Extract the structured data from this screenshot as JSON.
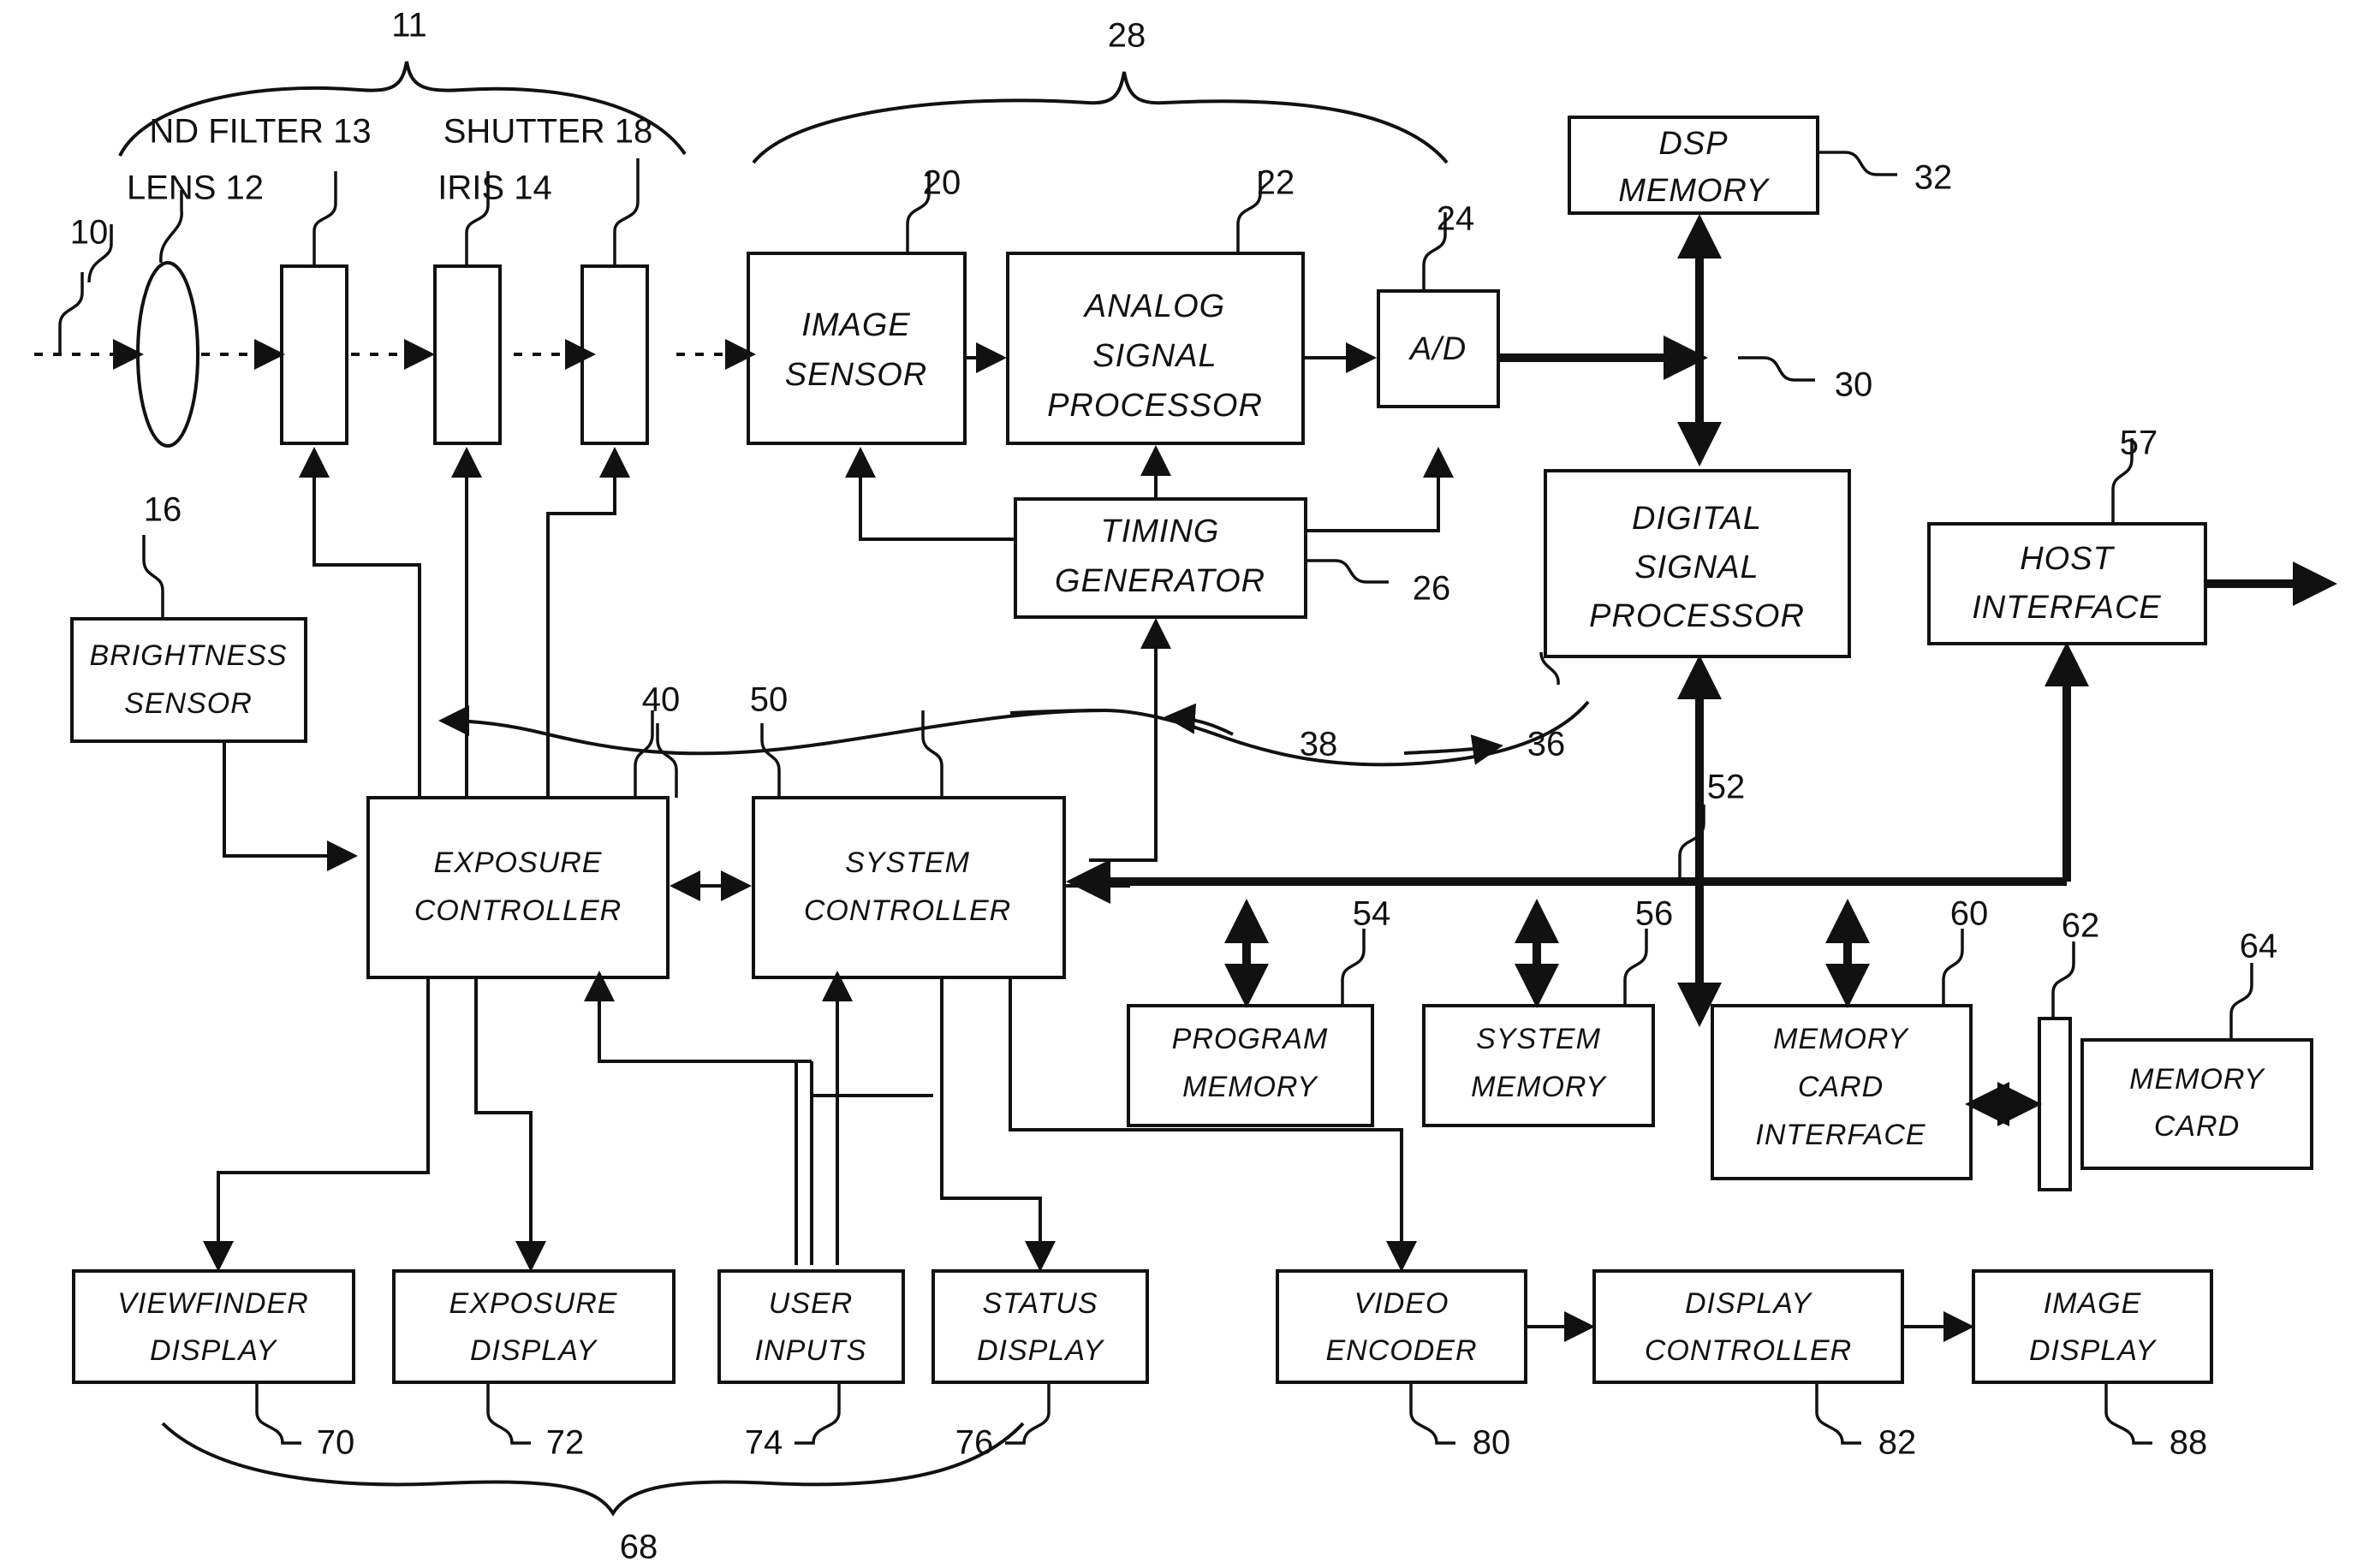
{
  "figure": {
    "type": "patent-block-diagram",
    "title": "Digital camera system block diagram",
    "system_reference": "10",
    "optics_group_reference": "11",
    "sensor_group_reference": "28",
    "display_group_reference": "68"
  },
  "optics_labels": {
    "nd_filter": "ND FILTER 13",
    "shutter": "SHUTTER 18",
    "lens": "LENS 12",
    "iris": "IRIS 14"
  },
  "blocks": {
    "image_sensor": {
      "line1": "IMAGE",
      "line2": "SENSOR",
      "ref": "20"
    },
    "analog_signal_processor": {
      "line1": "ANALOG",
      "line2": "SIGNAL",
      "line3": "PROCESSOR",
      "ref": "22"
    },
    "ad": {
      "line1": "A/D",
      "ref": "24"
    },
    "timing_generator": {
      "line1": "TIMING",
      "line2": "GENERATOR",
      "ref": "26"
    },
    "dsp_memory": {
      "line1": "DSP",
      "line2": "MEMORY",
      "ref": "32"
    },
    "digital_signal_processor": {
      "line1": "DIGITAL",
      "line2": "SIGNAL",
      "line3": "PROCESSOR",
      "ref": "36"
    },
    "host_interface": {
      "line1": "HOST",
      "line2": "INTERFACE",
      "ref": "57"
    },
    "brightness_sensor": {
      "line1": "BRIGHTNESS",
      "line2": "SENSOR",
      "ref": "16"
    },
    "exposure_controller": {
      "line1": "EXPOSURE",
      "line2": "CONTROLLER",
      "ref": "40"
    },
    "system_controller": {
      "line1": "SYSTEM",
      "line2": "CONTROLLER",
      "ref": "50"
    },
    "program_memory": {
      "line1": "PROGRAM",
      "line2": "MEMORY",
      "ref": "54"
    },
    "system_memory": {
      "line1": "SYSTEM",
      "line2": "MEMORY",
      "ref": "56"
    },
    "memory_card_interface": {
      "line1": "MEMORY",
      "line2": "CARD",
      "line3": "INTERFACE",
      "ref": "60"
    },
    "memory_card": {
      "line1": "MEMORY",
      "line2": "CARD",
      "ref": "64"
    },
    "memory_card_slot": {
      "ref": "62"
    },
    "viewfinder_display": {
      "line1": "VIEWFINDER",
      "line2": "DISPLAY",
      "ref": "70"
    },
    "exposure_display": {
      "line1": "EXPOSURE",
      "line2": "DISPLAY",
      "ref": "72"
    },
    "user_inputs": {
      "line1": "USER",
      "line2": "INPUTS",
      "ref": "74"
    },
    "status_display": {
      "line1": "STATUS",
      "line2": "DISPLAY",
      "ref": "76"
    },
    "video_encoder": {
      "line1": "VIDEO",
      "line2": "ENCODER",
      "ref": "80"
    },
    "display_controller": {
      "line1": "DISPLAY",
      "line2": "CONTROLLER",
      "ref": "82"
    },
    "image_display": {
      "line1": "IMAGE",
      "line2": "DISPLAY",
      "ref": "88"
    }
  },
  "bus_references": {
    "data_bus_dsp": "30",
    "control_bus_dsp": "38",
    "system_bus": "52"
  },
  "colors": {
    "ink": "#111111",
    "background": "#ffffff"
  }
}
